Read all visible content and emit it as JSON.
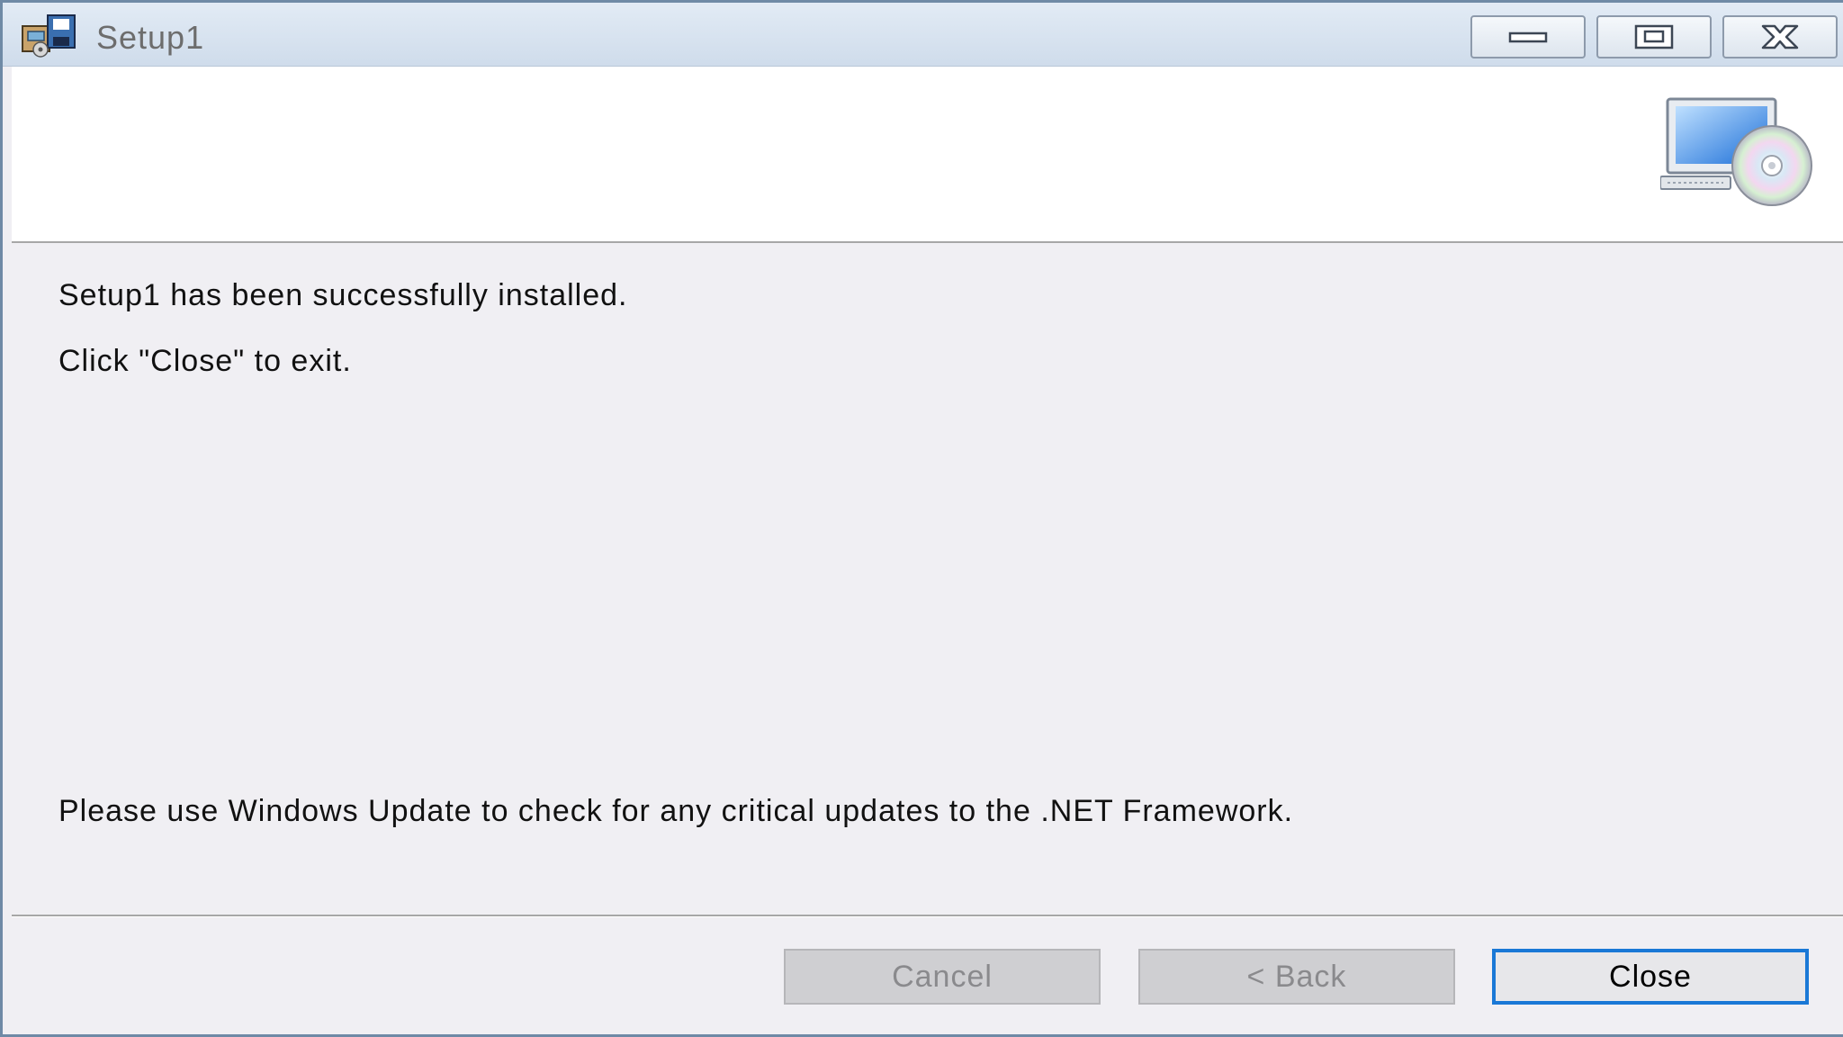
{
  "window": {
    "title": "Setup1"
  },
  "caption_buttons": {
    "minimize": "minimize-icon",
    "maximize": "maximize-icon",
    "close": "close-icon"
  },
  "messages": {
    "installed": "Setup1 has been successfully installed.",
    "click_close": "Click \"Close\" to exit.",
    "windows_update": "Please use Windows Update to check for any critical updates to the .NET Framework."
  },
  "buttons": {
    "cancel": "Cancel",
    "back": "< Back",
    "close": "Close"
  },
  "colors": {
    "focus_border": "#1a78d6",
    "dialog_background": "#f0eff3",
    "disabled_text": "#8a8a8d"
  }
}
